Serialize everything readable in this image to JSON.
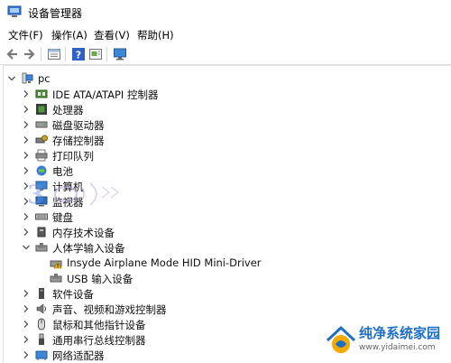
{
  "window": {
    "title": "设备管理器"
  },
  "menu": [
    {
      "label": "文件(F)"
    },
    {
      "label": "操作(A)"
    },
    {
      "label": "查看(V)"
    },
    {
      "label": "帮助(H)"
    }
  ],
  "toolbar": {
    "buttons": [
      "back-icon",
      "forward-icon",
      "properties-icon",
      "help-icon",
      "update-driver-icon",
      "monitor-icon"
    ]
  },
  "tree": {
    "root": {
      "label": "pc",
      "icon": "computer-icon"
    },
    "items": [
      {
        "label": "IDE ATA/ATAPI 控制器",
        "icon": "ide-controller-icon"
      },
      {
        "label": "处理器",
        "icon": "processor-icon"
      },
      {
        "label": "磁盘驱动器",
        "icon": "disk-drive-icon"
      },
      {
        "label": "存储控制器",
        "icon": "storage-controller-icon"
      },
      {
        "label": "打印队列",
        "icon": "printer-icon"
      },
      {
        "label": "电池",
        "icon": "battery-icon"
      },
      {
        "label": "计算机",
        "icon": "computer-icon"
      },
      {
        "label": "监视器",
        "icon": "monitor-icon"
      },
      {
        "label": "键盘",
        "icon": "keyboard-icon"
      },
      {
        "label": "内存技术设备",
        "icon": "memory-icon"
      },
      {
        "label": "人体学输入设备",
        "icon": "hid-icon",
        "expanded": true,
        "children": [
          {
            "label": "Insyde Airplane Mode HID Mini-Driver",
            "icon": "hid-warning-icon"
          },
          {
            "label": "USB 输入设备",
            "icon": "hid-device-icon"
          }
        ]
      },
      {
        "label": "软件设备",
        "icon": "software-device-icon"
      },
      {
        "label": "声音、视频和游戏控制器",
        "icon": "sound-icon"
      },
      {
        "label": "鼠标和其他指针设备",
        "icon": "mouse-icon"
      },
      {
        "label": "通用串行总线控制器",
        "icon": "usb-icon"
      },
      {
        "label": "网络适配器",
        "icon": "network-adapter-icon"
      }
    ]
  },
  "watermark": {
    "text": "3"
  },
  "logo": {
    "name": "纯净系统家园",
    "url": "www.yidaimei.com"
  },
  "colors": {
    "accent": "#1f6fc9",
    "chevron": "#555555",
    "warning": "#f2b705"
  }
}
